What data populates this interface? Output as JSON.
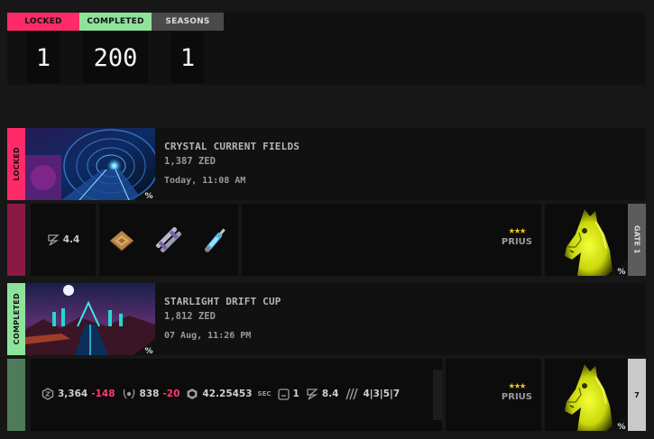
{
  "stats": {
    "locked_label": "LOCKED",
    "completed_label": "COMPLETED",
    "seasons_label": "SEASONS",
    "locked_value": "1",
    "completed_value": "200",
    "seasons_value": "1"
  },
  "races": [
    {
      "status": "LOCKED",
      "title": "CRYSTAL CURRENT FIELDS",
      "zed": "1,387 ZED",
      "time": "Today, 11:08 AM",
      "rating": "4.4",
      "horse": {
        "stars": "★★★",
        "name": "PRIUS"
      },
      "gate_label": "GATE 1"
    },
    {
      "status": "COMPLETED",
      "title": "STARLIGHT DRIFT CUP",
      "zed": "1,812 ZED",
      "time": "07 Aug, 11:26 PM",
      "stats": {
        "zed_value": "3,364",
        "zed_delta": "-148",
        "rank_value": "838",
        "rank_delta": "-20",
        "time_value": "42.25453",
        "time_unit": "SEC",
        "position": "1",
        "rating": "8.4",
        "splits": "4|3|5|7"
      },
      "horse": {
        "stars": "★★★",
        "name": "PRIUS"
      },
      "gate_number": "7"
    }
  ],
  "colors": {
    "locked": "#ff2b68",
    "completed": "#8ee39b",
    "seasons": "#4a4a4a",
    "star": "#f2c318",
    "negative": "#ff3b6b",
    "horse_neon": "#e6f20f"
  },
  "icons": {
    "zed_logo": "zed-z-icon",
    "hex_coin": "hex-coin-icon",
    "laurel": "laurel-icon",
    "clock": "stopwatch-icon",
    "position": "position-box-icon",
    "splits": "split-arrows-icon",
    "percent_badge": "percent-badge-icon"
  }
}
